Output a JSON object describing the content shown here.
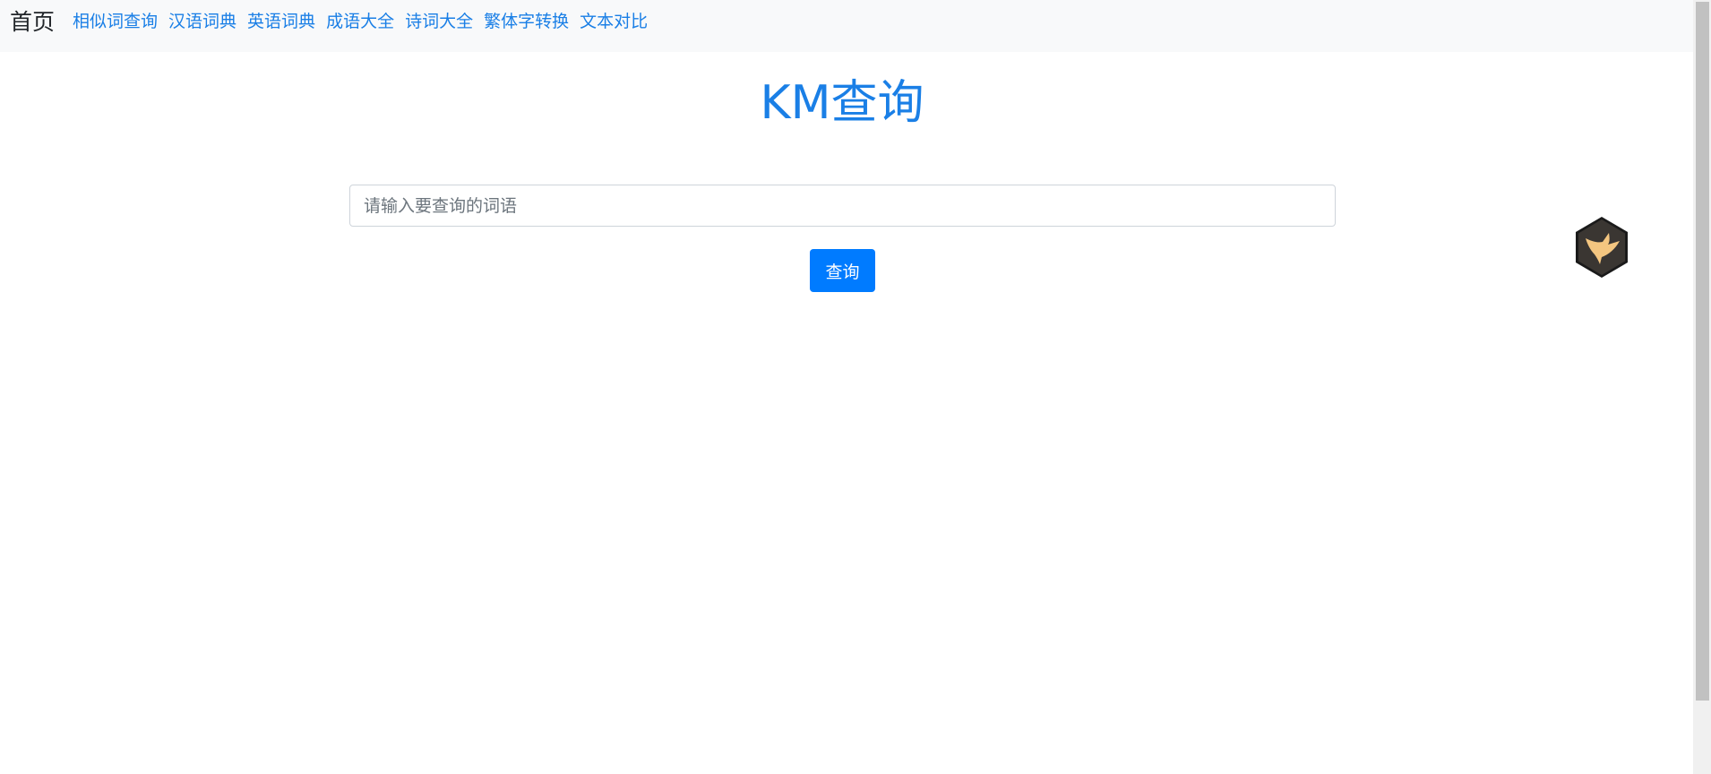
{
  "navbar": {
    "brand": "首页",
    "links": [
      {
        "label": "相似词查询"
      },
      {
        "label": "汉语词典"
      },
      {
        "label": "英语词典"
      },
      {
        "label": "成语大全"
      },
      {
        "label": "诗词大全"
      },
      {
        "label": "繁体字转换"
      },
      {
        "label": "文本对比"
      }
    ]
  },
  "main": {
    "title": "KM查询",
    "search": {
      "placeholder": "请输入要查询的词语",
      "value": ""
    },
    "submit_label": "查询"
  },
  "floating_widget": {
    "icon": "hummingbird-icon"
  },
  "colors": {
    "link": "#1a7fe6",
    "primary_button": "#007bff",
    "navbar_bg": "#f8f9fa",
    "badge_dark": "#2b2b2b",
    "badge_bird": "#f4c680"
  }
}
